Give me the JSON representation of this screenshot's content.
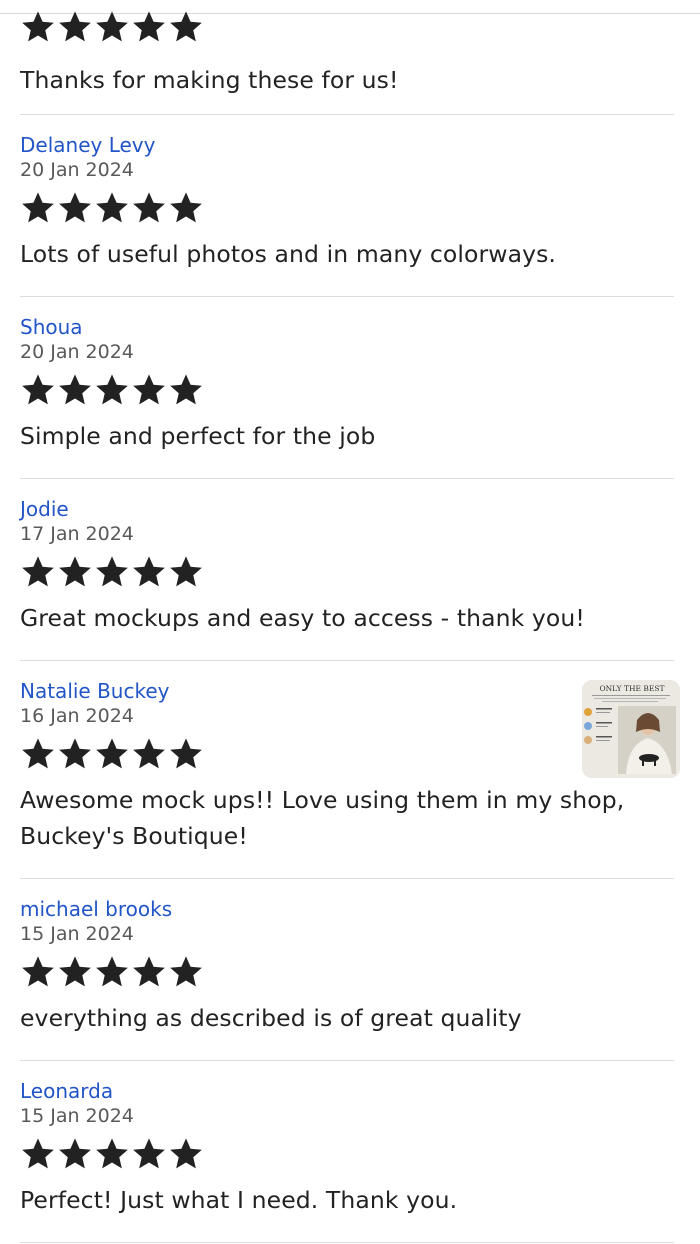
{
  "reviews": [
    {
      "text": "Thanks for making these for us!",
      "rating": 5
    },
    {
      "name": "Delaney Levy",
      "date": "20 Jan 2024",
      "rating": 5,
      "text": "Lots of useful photos and in many colorways."
    },
    {
      "name": "Shoua",
      "date": "20 Jan 2024",
      "rating": 5,
      "text": "Simple and perfect for the job"
    },
    {
      "name": "Jodie",
      "date": "17 Jan 2024",
      "rating": 5,
      "text": "Great mockups and easy to access - thank you!"
    },
    {
      "name": "Natalie Buckey",
      "date": "16 Jan 2024",
      "rating": 5,
      "text": "Awesome mock ups!! Love using them in my shop, Buckey's Boutique!",
      "photo": {
        "caption": "ONLY THE BEST"
      }
    },
    {
      "name": "michael brooks",
      "date": "15 Jan 2024",
      "rating": 5,
      "text": "everything as described is of great quality"
    },
    {
      "name": "Leonarda",
      "date": "15 Jan 2024",
      "rating": 5,
      "text": "Perfect! Just what I need. Thank you."
    }
  ],
  "icons": {
    "star": "star-icon"
  },
  "colors": {
    "name_link": "#2255c7",
    "star": "#222222",
    "date": "#595959",
    "divider": "#dcdcdc"
  }
}
